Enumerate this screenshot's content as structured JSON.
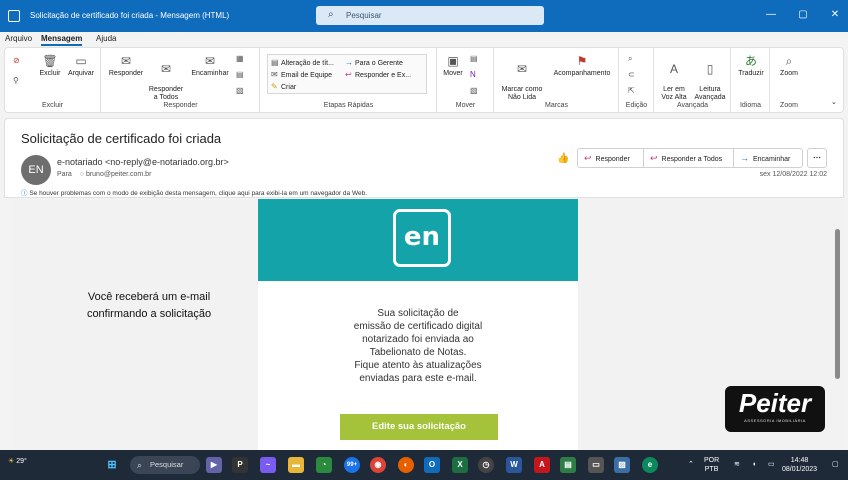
{
  "window": {
    "title": "Solicitação de certificado foi criada  -  Mensagem (HTML)",
    "search_placeholder": "Pesquisar",
    "minimize": "—",
    "restore": "▢",
    "close": "✕"
  },
  "menu": {
    "items": [
      "Arquivo",
      "Mensagem",
      "Ajuda"
    ],
    "active": "Mensagem"
  },
  "ribbon": {
    "groups": {
      "excluir": {
        "label": "Excluir",
        "buttons": [
          "Excluir",
          "Arquivar"
        ]
      },
      "responder": {
        "label": "Responder",
        "buttons": [
          "Responder",
          "Responder\na Todos",
          "Encaminhar"
        ]
      },
      "etapas": {
        "label": "Etapas Rápidas",
        "items": [
          "Alteração de tít...",
          "Para o Gerente",
          "Email de Equipe",
          "Responder e Ex...",
          "Criar"
        ]
      },
      "mover": {
        "label": "Mover",
        "buttons": [
          "Mover"
        ]
      },
      "marcas": {
        "label": "Marcas",
        "buttons": [
          "Marcar como\nNão Lida",
          "Acompanhamento"
        ]
      },
      "edicao": {
        "label": "Edição"
      },
      "avancada": {
        "label": "Avançada",
        "buttons": [
          "Ler em\nVoz Alta",
          "Leitura\nAvançada"
        ]
      },
      "idioma": {
        "label": "Idioma",
        "buttons": [
          "Traduzir"
        ]
      },
      "zoom": {
        "label": "Zoom",
        "buttons": [
          "Zoom"
        ]
      }
    }
  },
  "message": {
    "subject": "Solicitação de certificado foi criada",
    "avatar_initials": "EN",
    "sender": "e-notariado <no-reply@e-notariado.org.br>",
    "to_label": "Para",
    "to_address": "bruno@peiter.com.br",
    "info": "Se houver problemas com o modo de exibição desta mensagem, clique aqui para exibi-la em um navegador da Web.",
    "date": "sex 12/08/2022 12:02",
    "actions": [
      "Responder",
      "Responder a Todos",
      "Encaminhar"
    ]
  },
  "body": {
    "side_note": "Você receberá um e-mail confirmando a solicitação",
    "logo_text": "en",
    "text_lines": [
      "Sua solicitação de",
      "emissão de certificado digital",
      "notarizado foi enviada ao",
      "Tabelionato de Notas.",
      "Fique atento às atualizações",
      "enviadas para este e-mail."
    ],
    "cta": "Edite sua solicitação"
  },
  "watermark": {
    "main": "Peiter",
    "sub": "ASSESSORIA IMOBILIÁRIA"
  },
  "taskbar": {
    "weather": "29°",
    "search": "Pesquisar",
    "badge": "99+",
    "lang": "POR",
    "layout": "PTB",
    "time": "14:48",
    "date": "08/01/2023"
  },
  "colors": {
    "accent": "#0f6cbd",
    "banner": "#14a3a8",
    "cta": "#a4c33a",
    "taskbar": "#1f2a38"
  }
}
